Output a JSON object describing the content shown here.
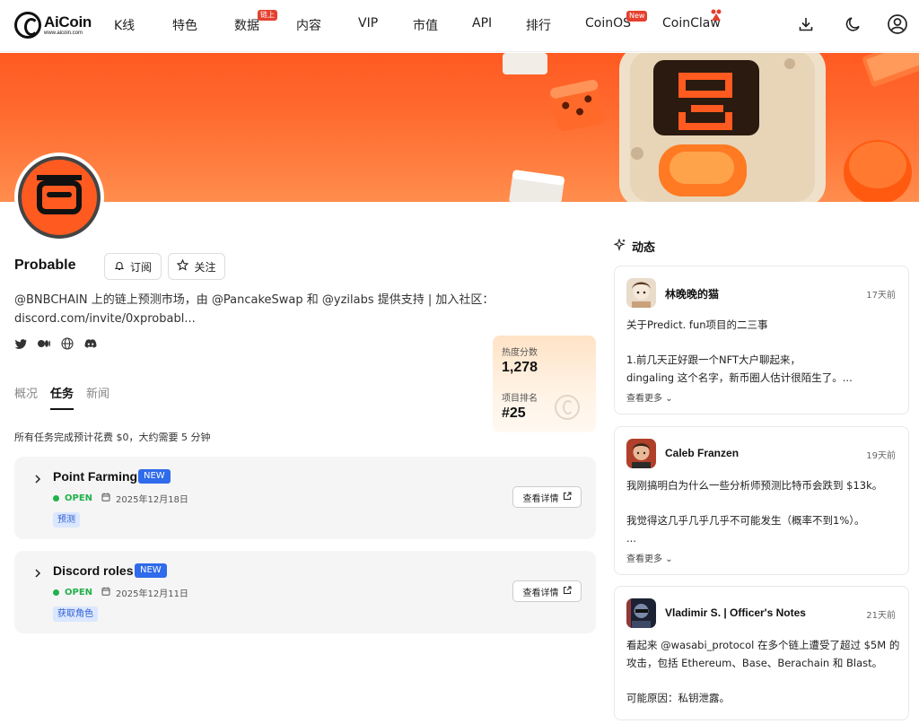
{
  "nav": {
    "logo_name": "AiCoin",
    "logo_url": "www.aicoin.com",
    "items": [
      {
        "label": "K线"
      },
      {
        "label": "特色"
      },
      {
        "label": "数据",
        "badge": "链上"
      },
      {
        "label": "内容"
      },
      {
        "label": "VIP"
      },
      {
        "label": "市值"
      },
      {
        "label": "API"
      },
      {
        "label": "排行"
      },
      {
        "label": "CoinOS",
        "badge": "New"
      },
      {
        "label": "CoinClaw"
      }
    ],
    "icons": [
      "download-icon",
      "moon-icon",
      "user-icon"
    ]
  },
  "project": {
    "name": "Probable",
    "subscribe_label": "订阅",
    "follow_label": "关注",
    "description": "@BNBCHAIN 上的链上预测市场，由 @PancakeSwap 和 @yzilabs 提供支持 | 加入社区：discord.com/invite/0xprobabl...",
    "socials": [
      "twitter-icon",
      "medium-icon",
      "globe-icon",
      "discord-icon"
    ]
  },
  "score": {
    "heat_label": "热度分数",
    "heat_value": "1,278",
    "rank_label": "项目排名",
    "rank_value": "#25"
  },
  "tabs": [
    {
      "label": "概况",
      "active": false
    },
    {
      "label": "任务",
      "active": true
    },
    {
      "label": "新闻",
      "active": false
    }
  ],
  "summary": "所有任务完成预计花费 $0，大约需要 5 分钟",
  "tasks": [
    {
      "name": "Point Farming",
      "badge": "NEW",
      "status": "OPEN",
      "date": "2025年12月18日",
      "tag": "预测",
      "detail_label": "查看详情"
    },
    {
      "name": "Discord roles",
      "badge": "NEW",
      "status": "OPEN",
      "date": "2025年12月11日",
      "tag": "获取角色",
      "detail_label": "查看详情"
    }
  ],
  "feed": {
    "title": "动态",
    "more_label": "查看更多",
    "posts": [
      {
        "author": "林晚晚的猫",
        "time": "17天前",
        "body": "关于Predict. fun项目的二三事\n\n1.前几天正好跟一个NFT大户聊起来，\ndingaling 这个名字，新币圈人估计很陌生了。..."
      },
      {
        "author": "Caleb Franzen",
        "time": "19天前",
        "body": "我刚搞明白为什么一些分析师预测比特币会跌到 $13k。\n\n我觉得这几乎几乎几乎不可能发生（概率不到1%）。\n..."
      },
      {
        "author": "Vladimir S. | Officer's Notes",
        "time": "21天前",
        "body": "看起来 @wasabi_protocol 在多个链上遭受了超过 $5M 的攻击，包括 Ethereum、Base、Berachain 和 Blast。\n\n可能原因：私钥泄露。"
      }
    ]
  },
  "colors": {
    "brand_orange": "#ff5a22",
    "new_badge_blue": "#2f6bea",
    "open_green": "#22b14c",
    "nav_badge_red": "#e5402f"
  }
}
